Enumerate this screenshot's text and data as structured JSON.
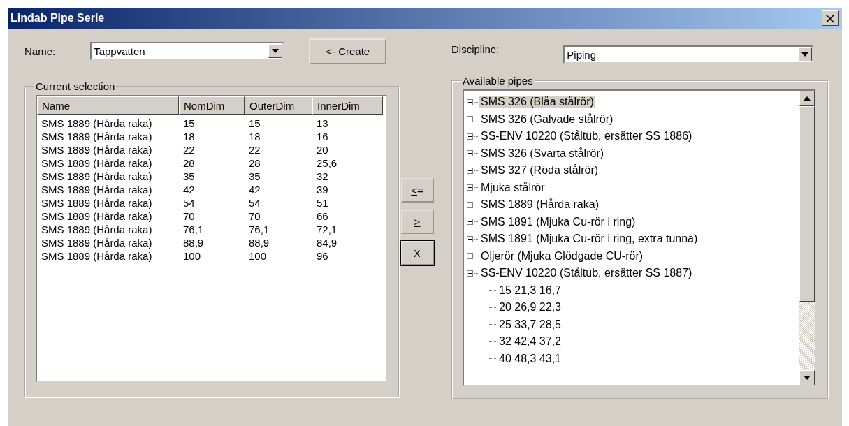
{
  "window": {
    "title": "Lindab Pipe Serie",
    "close": "×"
  },
  "name_field": {
    "label": "Name:",
    "value": "Tappvatten"
  },
  "create_button": "<- Create",
  "discipline_field": {
    "label": "Discipline:",
    "value": "Piping"
  },
  "current_selection": {
    "title": "Current selection",
    "columns": [
      "Name",
      "NomDim",
      "OuterDim",
      "InnerDim"
    ],
    "rows": [
      [
        "SMS 1889 (Hårda raka)",
        "15",
        "15",
        "13"
      ],
      [
        "SMS 1889 (Hårda raka)",
        "18",
        "18",
        "16"
      ],
      [
        "SMS 1889 (Hårda raka)",
        "22",
        "22",
        "20"
      ],
      [
        "SMS 1889 (Hårda raka)",
        "28",
        "28",
        "25,6"
      ],
      [
        "SMS 1889 (Hårda raka)",
        "35",
        "35",
        "32"
      ],
      [
        "SMS 1889 (Hårda raka)",
        "42",
        "42",
        "39"
      ],
      [
        "SMS 1889 (Hårda raka)",
        "54",
        "54",
        "51"
      ],
      [
        "SMS 1889 (Hårda raka)",
        "70",
        "70",
        "66"
      ],
      [
        "SMS 1889 (Hårda raka)",
        "76,1",
        "76,1",
        "72,1"
      ],
      [
        "SMS 1889 (Hårda raka)",
        "88,9",
        "88,9",
        "84,9"
      ],
      [
        "SMS 1889 (Hårda raka)",
        "100",
        "100",
        "96"
      ]
    ]
  },
  "move_buttons": [
    {
      "label": "<=",
      "kind": "add",
      "default": false
    },
    {
      "label": ">",
      "kind": "remove",
      "default": false
    },
    {
      "label": "X",
      "kind": "clear",
      "default": true
    }
  ],
  "available_pipes": {
    "title": "Available pipes",
    "items": [
      {
        "label": "SMS 326 (Blåa stålrör)",
        "expanded": false,
        "selected": true
      },
      {
        "label": "SMS 326 (Galvade stålrör)",
        "expanded": false,
        "selected": false
      },
      {
        "label": "SS-ENV 10220 (Ståltub, ersätter SS 1886)",
        "expanded": false,
        "selected": false
      },
      {
        "label": "SMS 326 (Svarta stålrör)",
        "expanded": false,
        "selected": false
      },
      {
        "label": "SMS 327 (Röda stålrör)",
        "expanded": false,
        "selected": false
      },
      {
        "label": "Mjuka stålrör",
        "expanded": false,
        "selected": false
      },
      {
        "label": "SMS 1889 (Hårda raka)",
        "expanded": false,
        "selected": false
      },
      {
        "label": "SMS 1891 (Mjuka Cu-rör i ring)",
        "expanded": false,
        "selected": false
      },
      {
        "label": "SMS 1891 (Mjuka Cu-rör i ring, extra tunna)",
        "expanded": false,
        "selected": false
      },
      {
        "label": "Oljerör (Mjuka Glödgade CU-rör)",
        "expanded": false,
        "selected": false
      },
      {
        "label": "SS-ENV 10220 (Ståltub, ersätter SS 1887)",
        "expanded": true,
        "selected": false,
        "children": [
          {
            "label": "15 21,3 16,7",
            "selected": false
          },
          {
            "label": "20 26,9 22,3",
            "selected": false
          },
          {
            "label": "25 33,7 28,5",
            "selected": false
          },
          {
            "label": "32 42,4 37,2",
            "selected": false
          },
          {
            "label": "40 48,3 43,1",
            "selected": false
          }
        ]
      }
    ]
  }
}
